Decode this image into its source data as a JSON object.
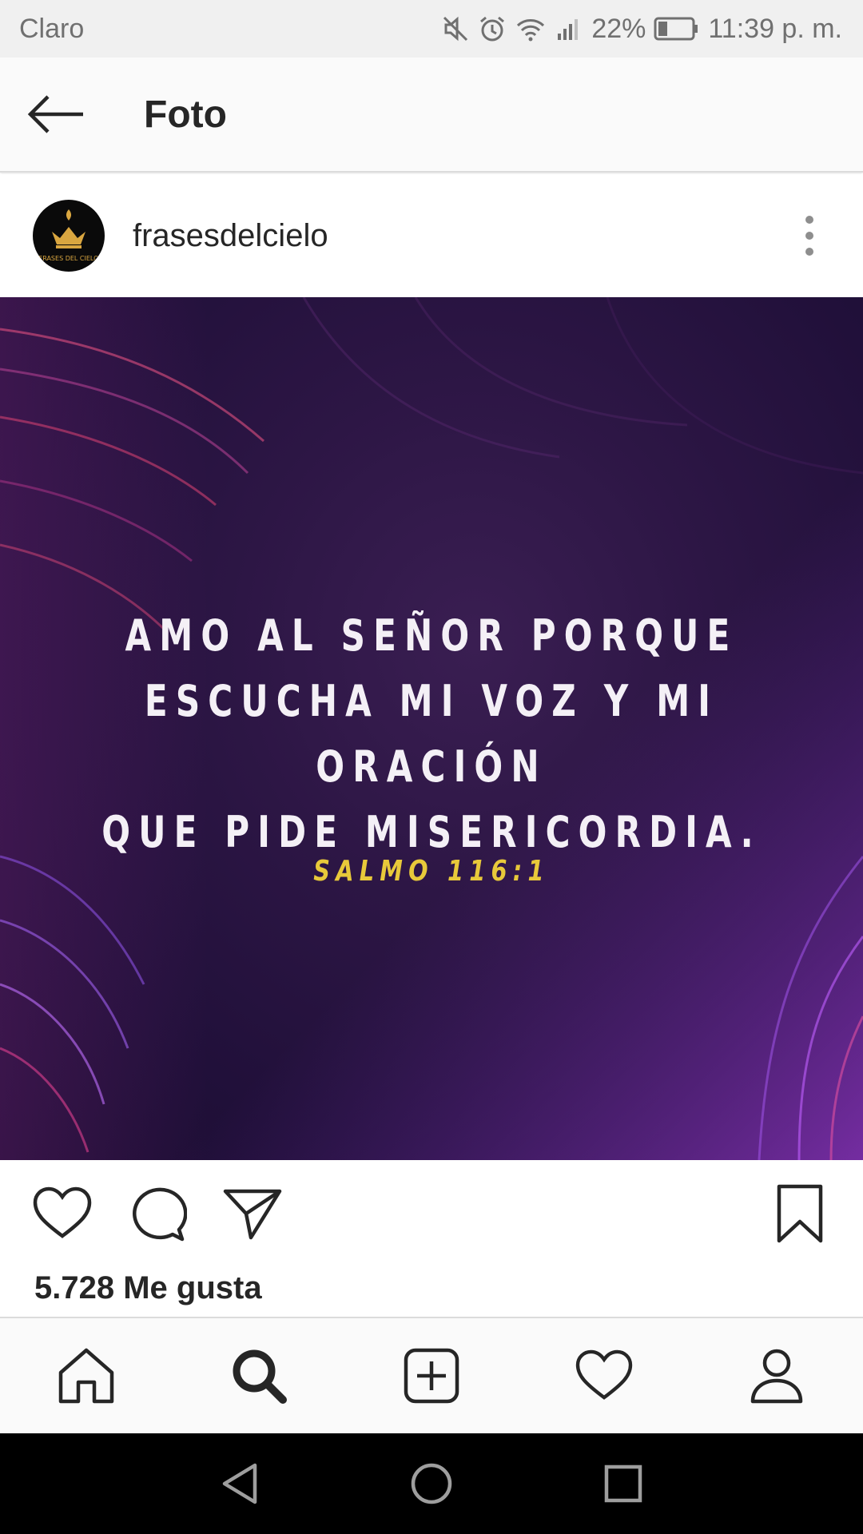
{
  "status_bar": {
    "carrier": "Claro",
    "battery": "22%",
    "time": "11:39 p. m.",
    "icons": [
      "mute-icon",
      "alarm-icon",
      "wifi-icon",
      "signal-icon",
      "battery-icon"
    ]
  },
  "app_bar": {
    "title": "Foto",
    "back_icon": "arrow-left-icon"
  },
  "post": {
    "username": "frasesdelcielo",
    "avatar_text": "FRASES DEL CIELO",
    "quote_lines": [
      "AMO AL SEÑOR PORQUE",
      "ESCUCHA MI VOZ Y MI ORACIÓN",
      "QUE PIDE MISERICORDIA."
    ],
    "reference": "SALMO 116:1",
    "likes": "5.728 Me gusta"
  },
  "actions": [
    "heart-icon",
    "comment-icon",
    "share-icon",
    "bookmark-icon"
  ],
  "bottom_nav": [
    "home-icon",
    "search-icon",
    "new-post-icon",
    "activity-icon",
    "profile-icon"
  ],
  "system_nav": [
    "back-icon",
    "home-circle-icon",
    "recents-icon"
  ],
  "colors": {
    "text": "#262626",
    "reference_yellow": "#e8c93a",
    "image_purple": "#2d1645"
  }
}
